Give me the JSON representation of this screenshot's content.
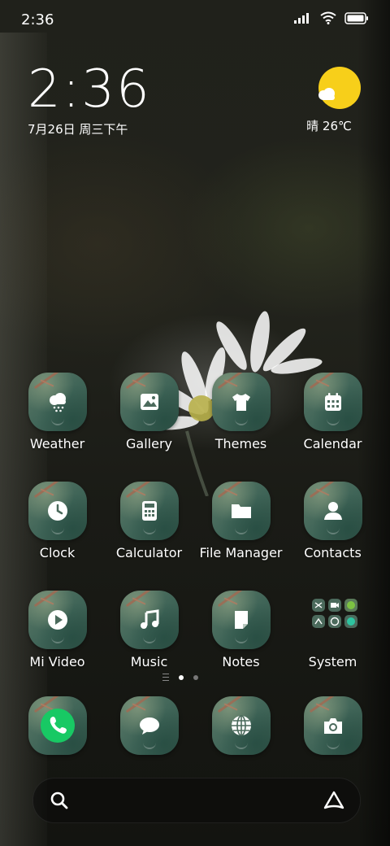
{
  "status_bar": {
    "time": "2:36"
  },
  "clock_widget": {
    "time": "2:36",
    "date": "7月26日 周三下午"
  },
  "weather_widget": {
    "condition_temp": "晴 26℃"
  },
  "apps": [
    [
      {
        "label": "Weather",
        "icon": "weather-icon"
      },
      {
        "label": "Gallery",
        "icon": "gallery-icon"
      },
      {
        "label": "Themes",
        "icon": "themes-icon"
      },
      {
        "label": "Calendar",
        "icon": "calendar-icon"
      }
    ],
    [
      {
        "label": "Clock",
        "icon": "clock-icon"
      },
      {
        "label": "Calculator",
        "icon": "calculator-icon"
      },
      {
        "label": "File Manager",
        "icon": "folder-icon"
      },
      {
        "label": "Contacts",
        "icon": "contacts-icon"
      }
    ],
    [
      {
        "label": "Mi Video",
        "icon": "play-icon"
      },
      {
        "label": "Music",
        "icon": "music-icon"
      },
      {
        "label": "Notes",
        "icon": "notes-icon"
      },
      {
        "label": "System",
        "icon": "folder-grid-icon"
      }
    ]
  ],
  "dock": [
    {
      "name": "phone",
      "icon": "phone-icon",
      "accent": "#18c964"
    },
    {
      "name": "messages",
      "icon": "message-icon"
    },
    {
      "name": "browser",
      "icon": "globe-icon"
    },
    {
      "name": "camera",
      "icon": "camera-icon"
    }
  ],
  "page_indicator": {
    "pages": 2,
    "active": 1
  },
  "colors": {
    "sun": "#f7cf1a",
    "phone_green": "#18c964",
    "icon_bg": "#3f6457"
  }
}
